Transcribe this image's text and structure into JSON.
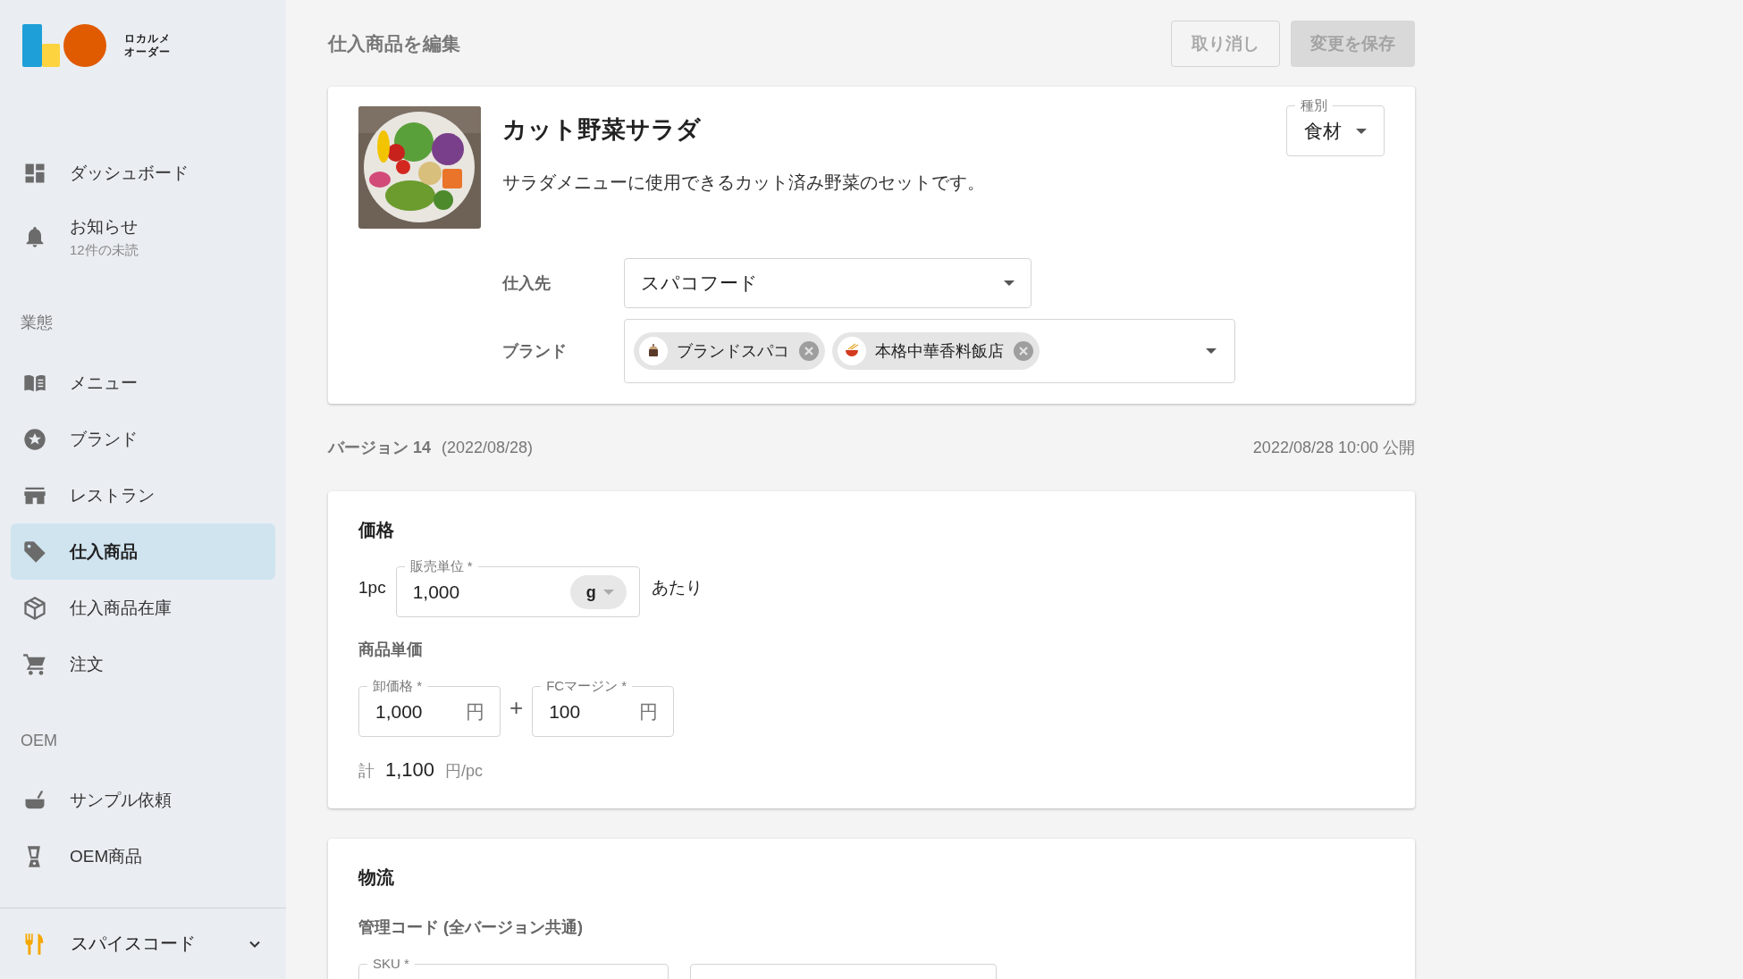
{
  "sidebar": {
    "logo_lines": [
      "ロカルメ",
      "オーダー"
    ],
    "nav": [
      {
        "kind": "item",
        "label": "ダッシュボード",
        "selected": false
      },
      {
        "kind": "item",
        "label": "お知らせ",
        "sub": "12件の未読",
        "selected": false
      },
      {
        "kind": "section",
        "label": "業態"
      },
      {
        "kind": "item",
        "label": "メニュー",
        "selected": false
      },
      {
        "kind": "item",
        "label": "ブランド",
        "selected": false
      },
      {
        "kind": "item",
        "label": "レストラン",
        "selected": false
      },
      {
        "kind": "item",
        "label": "仕入商品",
        "selected": true
      },
      {
        "kind": "item",
        "label": "仕入商品在庫",
        "selected": false
      },
      {
        "kind": "item",
        "label": "注文",
        "selected": false
      },
      {
        "kind": "section",
        "label": "OEM"
      },
      {
        "kind": "item",
        "label": "サンプル依頼",
        "selected": false
      },
      {
        "kind": "item",
        "label": "OEM商品",
        "selected": false
      }
    ],
    "footer": {
      "label": "スパイスコード"
    }
  },
  "main": {
    "title": "仕入商品を編集",
    "buttons": [
      {
        "label": "取り消し",
        "kind": "outlined",
        "disabled": true
      },
      {
        "label": "変更を保存",
        "kind": "filled",
        "disabled": true
      }
    ],
    "product": {
      "kind": "picture",
      "name": "カット野菜サラダ",
      "description": "サラダメニューに使用できるカット済み野菜のセットです。",
      "category": {
        "label": "種別",
        "value": "食材"
      },
      "supplier": {
        "label": "仕入先",
        "value": "スパコフード"
      },
      "brands": {
        "label": "ブランド",
        "chips": [
          "ブランドスパコ",
          "本格中華香料飯店"
        ]
      }
    },
    "version": {
      "label": "バージョン 14",
      "date": "(2022/08/28)",
      "published": "2022/08/28 10:00 公開"
    },
    "price": {
      "title": "価格",
      "unit_prefix": "1pc",
      "unit_field": {
        "label": "販売単位 *",
        "value": "1,000",
        "unit": "g"
      },
      "unit_suffix": "あたり",
      "unit_price_title": "商品単価",
      "wholesale": {
        "label": "卸価格 *",
        "value": "1,000",
        "suffix": "円"
      },
      "plus": "+",
      "margin": {
        "label": "FCマージン *",
        "value": "100",
        "suffix": "円"
      },
      "total": {
        "label": "計",
        "value": "1,100",
        "unit": "円/pc"
      }
    },
    "logistics": {
      "title": "物流",
      "code_title": "管理コード (全バージョン共通)",
      "fields": [
        {
          "kind": "labeled",
          "label": "SKU *"
        },
        {
          "kind": "empty"
        }
      ]
    }
  }
}
